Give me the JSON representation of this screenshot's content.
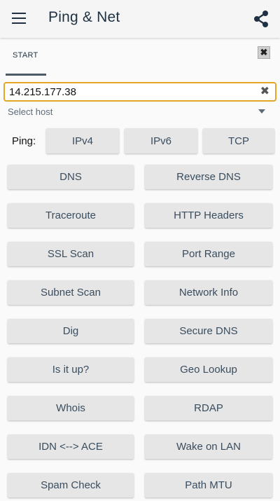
{
  "app": {
    "title": "Ping & Net",
    "menu_icon": "hamburger-icon",
    "share_icon": "share-icon"
  },
  "tabs": [
    {
      "label": "START",
      "active": true
    }
  ],
  "close_label": "✖",
  "host": {
    "value": "14.215.177.38",
    "clear_icon": "✖",
    "select_label": "Select host",
    "accent_color": "#e5a628"
  },
  "ping": {
    "label": "Ping:",
    "buttons": [
      "IPv4",
      "IPv6",
      "TCP"
    ]
  },
  "tools": [
    [
      "DNS",
      "Reverse DNS"
    ],
    [
      "Traceroute",
      "HTTP Headers"
    ],
    [
      "SSL Scan",
      "Port Range"
    ],
    [
      "Subnet Scan",
      "Network Info"
    ],
    [
      "Dig",
      "Secure DNS"
    ],
    [
      "Is it up?",
      "Geo Lookup"
    ],
    [
      "Whois",
      "RDAP"
    ],
    [
      "IDN <--> ACE",
      "Wake on LAN"
    ],
    [
      "Spam Check",
      "Path MTU"
    ]
  ]
}
